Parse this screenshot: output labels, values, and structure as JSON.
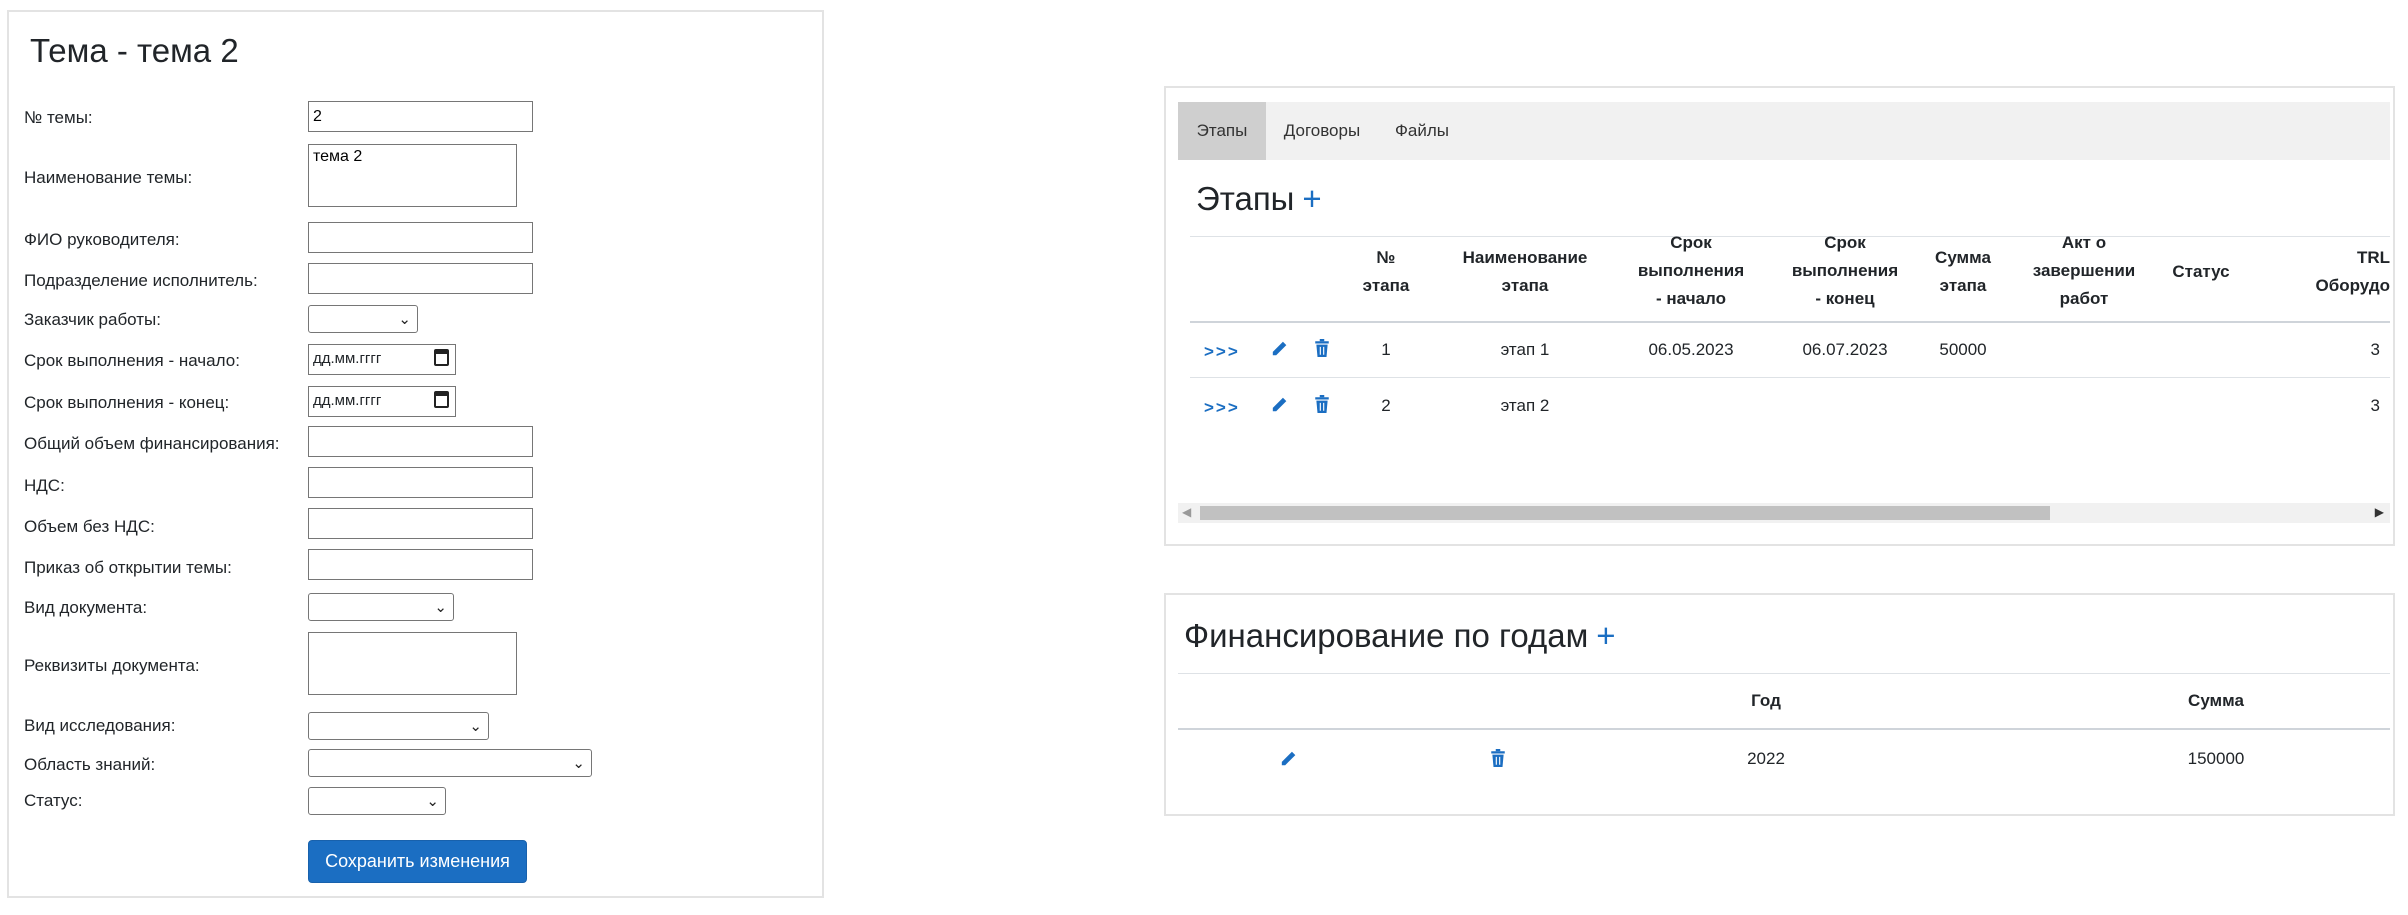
{
  "form": {
    "title": "Тема - тема 2",
    "fields": {
      "topic_no": {
        "label": "№ темы:",
        "value": "2"
      },
      "topic_name": {
        "label": "Наименование темы:",
        "value": "тема 2"
      },
      "manager": {
        "label": "ФИО руководителя:",
        "value": ""
      },
      "department": {
        "label": "Подразделение исполнитель:",
        "value": ""
      },
      "customer": {
        "label": "Заказчик работы:",
        "value": ""
      },
      "start_date": {
        "label": "Срок выполнения - начало:",
        "placeholder": "дд.мм.гггг"
      },
      "end_date": {
        "label": "Срок выполнения - конец:",
        "placeholder": "дд.мм.гггг"
      },
      "total_funding": {
        "label": "Общий объем финансирования:",
        "value": ""
      },
      "vat": {
        "label": "НДС:",
        "value": ""
      },
      "amount_no_vat": {
        "label": "Объем без НДС:",
        "value": ""
      },
      "open_order": {
        "label": "Приказ об открытии темы:",
        "value": ""
      },
      "doc_type": {
        "label": "Вид документа:",
        "value": ""
      },
      "doc_details": {
        "label": "Реквизиты документа:",
        "value": ""
      },
      "research_type": {
        "label": "Вид исследования:",
        "value": ""
      },
      "knowledge_area": {
        "label": "Область знаний:",
        "value": ""
      },
      "status": {
        "label": "Статус:",
        "value": ""
      }
    },
    "save_label": "Сохранить изменения"
  },
  "stages_panel": {
    "tabs": [
      "Этапы",
      "Договоры",
      "Файлы"
    ],
    "active_tab": 0,
    "title": "Этапы",
    "plus": "+",
    "headers": {
      "no": [
        "№",
        "этапа"
      ],
      "name": [
        "Наименование",
        "этапа"
      ],
      "start": [
        "Срок",
        "выполнения",
        "- начало"
      ],
      "end": [
        "Срок",
        "выполнения",
        "- конец"
      ],
      "sum": [
        "Сумма",
        "этапа"
      ],
      "act": [
        "Акт о",
        "завершении",
        "работ"
      ],
      "status": [
        "Статус"
      ],
      "trl": [
        "TRL",
        "Оборудо"
      ]
    },
    "rows": [
      {
        "open": ">>>",
        "no": "1",
        "name": "этап 1",
        "start": "06.05.2023",
        "end": "06.07.2023",
        "sum": "50000",
        "act": "",
        "status": "",
        "trl": "3"
      },
      {
        "open": ">>>",
        "no": "2",
        "name": "этап 2",
        "start": "",
        "end": "",
        "sum": "",
        "act": "",
        "status": "",
        "trl": "3"
      }
    ]
  },
  "financing": {
    "title": "Финансирование по годам",
    "plus": "+",
    "headers": {
      "year": "Год",
      "sum": "Сумма"
    },
    "rows": [
      {
        "year": "2022",
        "sum": "150000"
      }
    ]
  },
  "colors": {
    "accent": "#1b6ec2",
    "tab_bg": "#f1f1f1",
    "tab_active_bg": "#cfcfcf"
  },
  "icons": {
    "open": "open-arrows-icon",
    "edit": "pencil-icon",
    "delete": "trash-icon"
  }
}
